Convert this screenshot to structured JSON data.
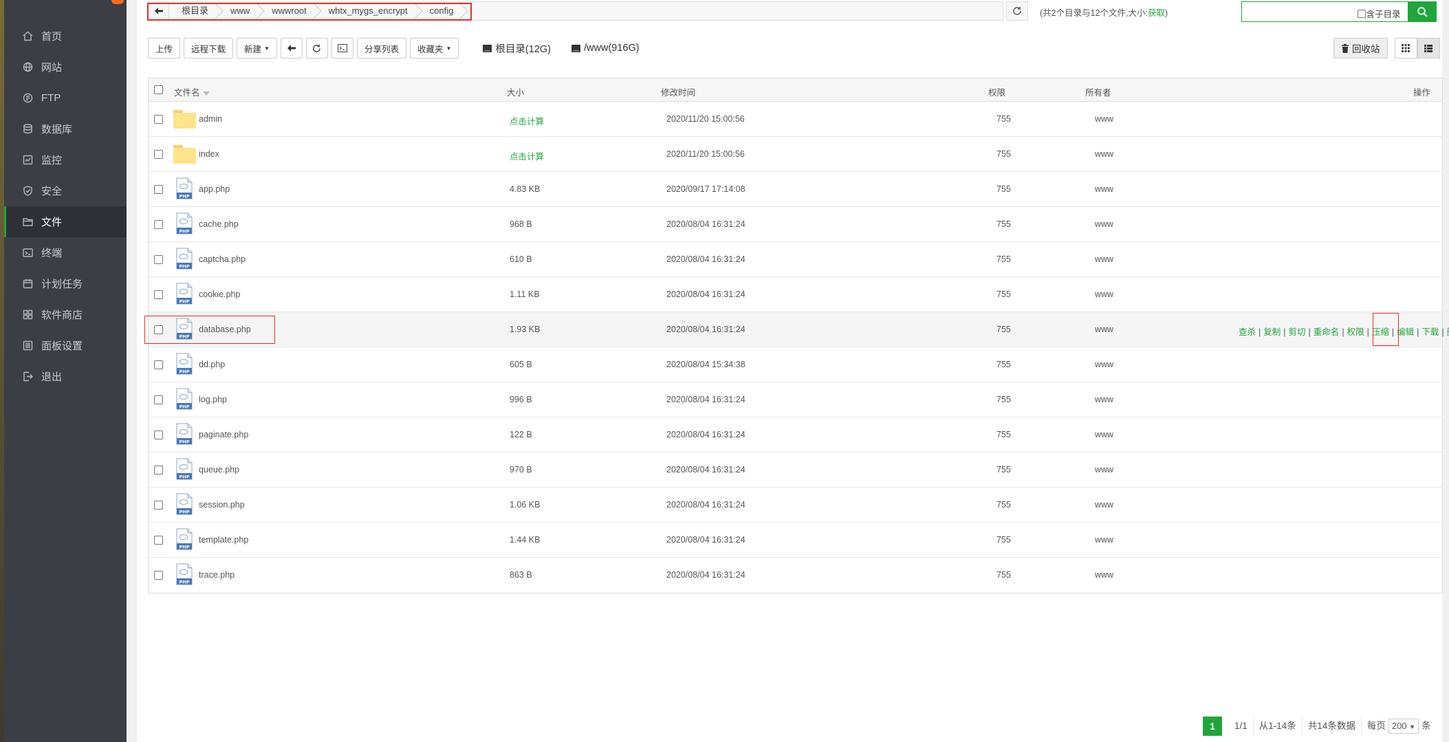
{
  "nav": [
    {
      "label": "首页",
      "icon": "home-icon"
    },
    {
      "label": "网站",
      "icon": "globe-icon"
    },
    {
      "label": "FTP",
      "icon": "ftp-icon"
    },
    {
      "label": "数据库",
      "icon": "database-icon"
    },
    {
      "label": "监控",
      "icon": "monitor-icon"
    },
    {
      "label": "安全",
      "icon": "shield-icon"
    },
    {
      "label": "文件",
      "icon": "folder-icon",
      "active": true
    },
    {
      "label": "终端",
      "icon": "terminal-icon"
    },
    {
      "label": "计划任务",
      "icon": "calendar-icon"
    },
    {
      "label": "软件商店",
      "icon": "apps-icon"
    },
    {
      "label": "面板设置",
      "icon": "settings-icon"
    },
    {
      "label": "退出",
      "icon": "logout-icon"
    }
  ],
  "path": [
    "根目录",
    "www",
    "wwwroot",
    "whtx_mygs_encrypt",
    "config"
  ],
  "summary": {
    "text": "(共2个目录与12个文件,大小:",
    "link": "获取",
    "close": ")"
  },
  "search": {
    "placeholder": "",
    "subdir_label": "包含子目录"
  },
  "toolbar": {
    "upload": "上传",
    "remote_download": "远程下载",
    "new": "新建",
    "share_list": "分享列表",
    "favorites": "收藏夹",
    "disk_root": "根目录(12G)",
    "disk_www": "/www(916G)",
    "recycle": "回收站"
  },
  "columns": {
    "name": "文件名",
    "size": "大小",
    "mtime": "修改时间",
    "perm": "权限",
    "owner": "所有者",
    "ops": "操作"
  },
  "files": [
    {
      "name": "admin",
      "type": "dir",
      "size": "点击计算",
      "mtime": "2020/11/20 15:00:56",
      "perm": "755",
      "owner": "www"
    },
    {
      "name": "index",
      "type": "dir",
      "size": "点击计算",
      "mtime": "2020/11/20 15:00:56",
      "perm": "755",
      "owner": "www"
    },
    {
      "name": "app.php",
      "type": "php",
      "size": "4.83 KB",
      "mtime": "2020/09/17 17:14:08",
      "perm": "755",
      "owner": "www"
    },
    {
      "name": "cache.php",
      "type": "php",
      "size": "968 B",
      "mtime": "2020/08/04 16:31:24",
      "perm": "755",
      "owner": "www"
    },
    {
      "name": "captcha.php",
      "type": "php",
      "size": "610 B",
      "mtime": "2020/08/04 16:31:24",
      "perm": "755",
      "owner": "www"
    },
    {
      "name": "cookie.php",
      "type": "php",
      "size": "1.11 KB",
      "mtime": "2020/08/04 16:31:24",
      "perm": "755",
      "owner": "www"
    },
    {
      "name": "database.php",
      "type": "php",
      "size": "1.93 KB",
      "mtime": "2020/08/04 16:31:24",
      "perm": "755",
      "owner": "www",
      "hover": true
    },
    {
      "name": "dd.php",
      "type": "php",
      "size": "605 B",
      "mtime": "2020/08/04 15:34:38",
      "perm": "755",
      "owner": "www"
    },
    {
      "name": "log.php",
      "type": "php",
      "size": "996 B",
      "mtime": "2020/08/04 16:31:24",
      "perm": "755",
      "owner": "www"
    },
    {
      "name": "paginate.php",
      "type": "php",
      "size": "122 B",
      "mtime": "2020/08/04 16:31:24",
      "perm": "755",
      "owner": "www"
    },
    {
      "name": "queue.php",
      "type": "php",
      "size": "970 B",
      "mtime": "2020/08/04 16:31:24",
      "perm": "755",
      "owner": "www"
    },
    {
      "name": "session.php",
      "type": "php",
      "size": "1.06 KB",
      "mtime": "2020/08/04 16:31:24",
      "perm": "755",
      "owner": "www"
    },
    {
      "name": "template.php",
      "type": "php",
      "size": "1.44 KB",
      "mtime": "2020/08/04 16:31:24",
      "perm": "755",
      "owner": "www"
    },
    {
      "name": "trace.php",
      "type": "php",
      "size": "863 B",
      "mtime": "2020/08/04 16:31:24",
      "perm": "755",
      "owner": "www"
    }
  ],
  "row_ops": [
    "查杀",
    "复制",
    "剪切",
    "重命名",
    "权限",
    "压缩",
    "编辑",
    "下载",
    "删除"
  ],
  "php_icon_text": "PHP",
  "pager": {
    "current": "1",
    "pages": "1/1",
    "range": "从1-14条",
    "total": "共14条数据",
    "per_page_label": "每页",
    "per_page": "200",
    "unit": "条"
  },
  "colors": {
    "accent": "#20a53a",
    "highlight": "#e0312b",
    "sidebar": "#3b3e45"
  }
}
